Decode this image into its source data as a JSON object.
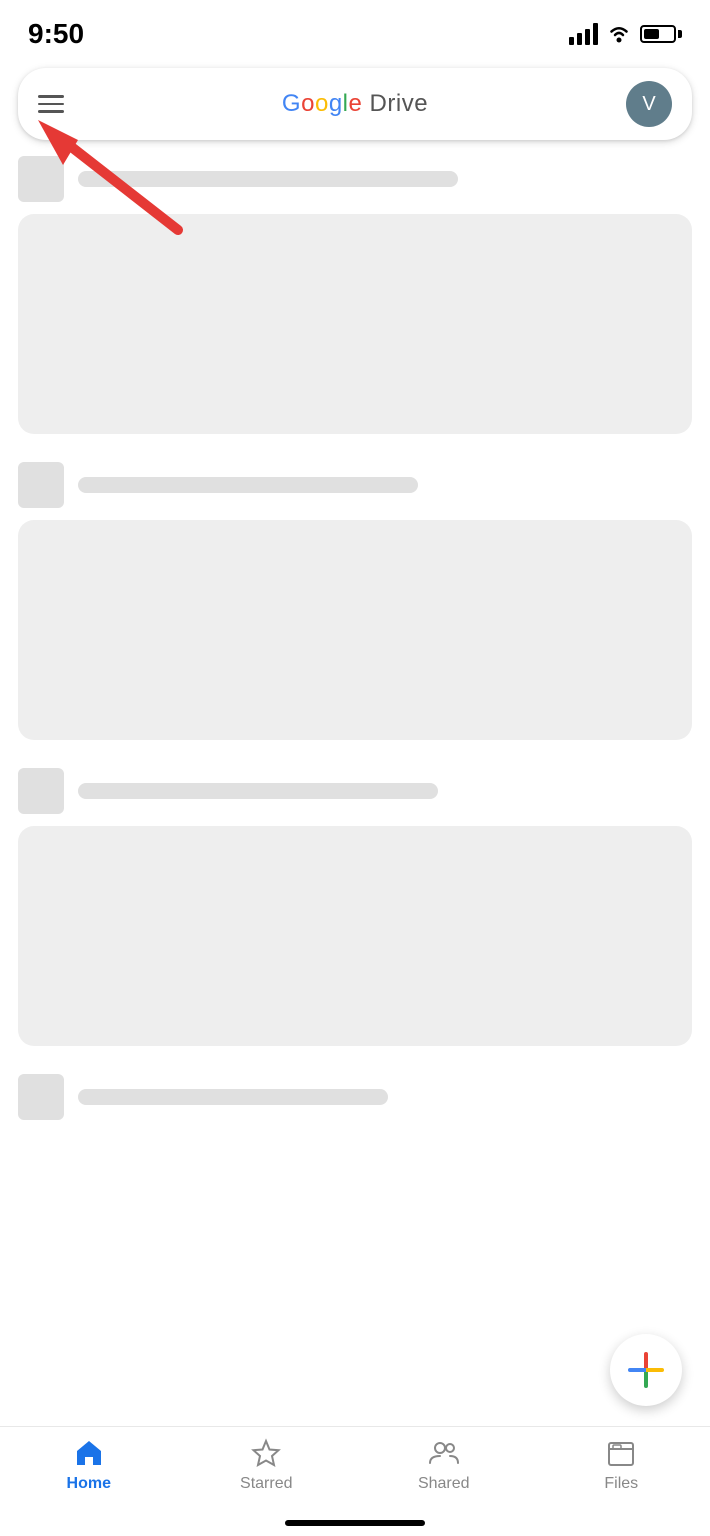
{
  "statusBar": {
    "time": "9:50",
    "signal": "full",
    "wifi": "on",
    "battery": "half"
  },
  "header": {
    "menuIcon": "menu-icon",
    "title": "Google Drive",
    "avatarLabel": "V"
  },
  "skeletonItems": [
    {
      "id": 1
    },
    {
      "id": 2
    },
    {
      "id": 3
    },
    {
      "id": 4
    }
  ],
  "fab": {
    "label": "New"
  },
  "bottomNav": {
    "items": [
      {
        "id": "home",
        "label": "Home",
        "icon": "🏠",
        "active": true
      },
      {
        "id": "starred",
        "label": "Starred",
        "icon": "☆",
        "active": false
      },
      {
        "id": "shared",
        "label": "Shared",
        "icon": "👥",
        "active": false
      },
      {
        "id": "files",
        "label": "Files",
        "icon": "🗂",
        "active": false
      }
    ]
  }
}
